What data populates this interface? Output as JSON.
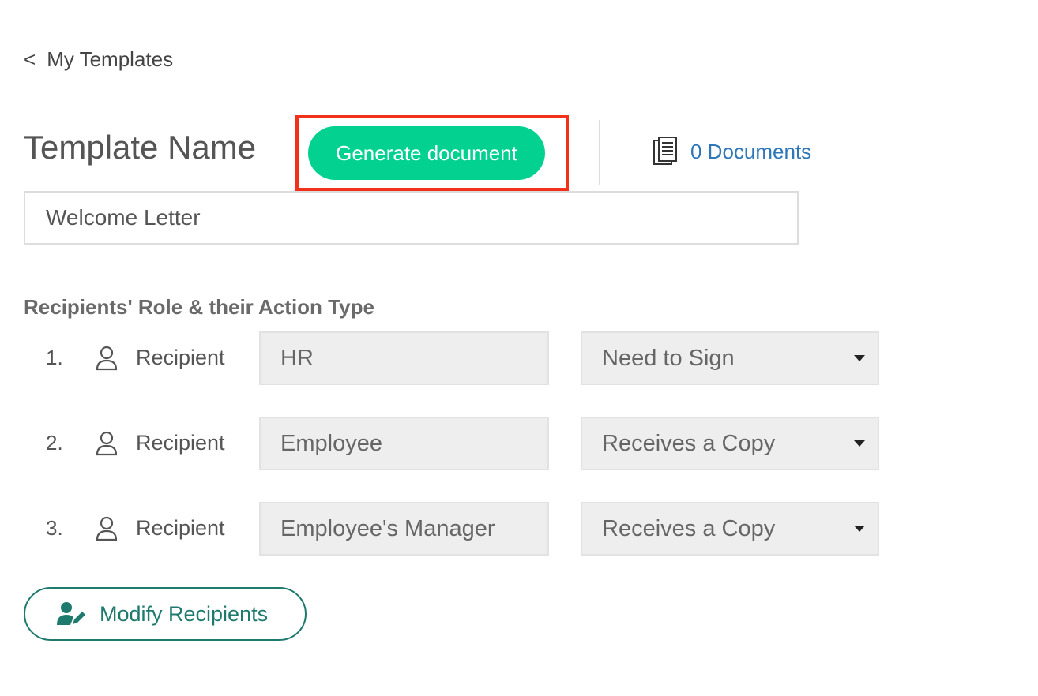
{
  "nav": {
    "back_chevron": "<",
    "back_label": "My Templates"
  },
  "header": {
    "title": "Template Name",
    "generate_button_label": "Generate document",
    "documents_link_label": "0 Documents"
  },
  "template_name": {
    "value": "Welcome Letter"
  },
  "recipients": {
    "heading": "Recipients' Role & their Action Type",
    "rows": [
      {
        "number": "1.",
        "label": "Recipient",
        "role": "HR",
        "action": "Need to Sign"
      },
      {
        "number": "2.",
        "label": "Recipient",
        "role": "Employee",
        "action": "Receives a Copy"
      },
      {
        "number": "3.",
        "label": "Recipient",
        "role": "Employee's Manager",
        "action": "Receives a Copy"
      }
    ]
  },
  "actions": {
    "modify_recipients_label": "Modify Recipients"
  },
  "icons": {
    "back": "chevron-left-icon",
    "documents": "document-stack-icon",
    "recipient": "person-outline-icon",
    "dropdown": "caret-down-icon",
    "modify": "user-edit-icon"
  },
  "colors": {
    "primary_green": "#03d190",
    "teal": "#1f7a6e",
    "link_blue": "#2f77b8",
    "highlight_red": "#f2311b"
  }
}
